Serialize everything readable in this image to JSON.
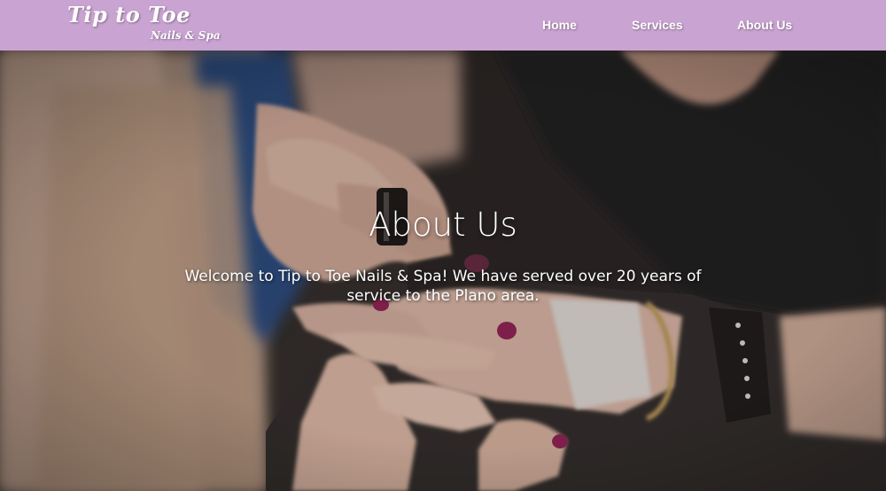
{
  "brand": {
    "title": "Tip to Toe",
    "subtitle": "Nails & Spa"
  },
  "nav": {
    "items": [
      {
        "label": "Home"
      },
      {
        "label": "Services"
      },
      {
        "label": "About Us"
      }
    ]
  },
  "hero": {
    "title": "About Us",
    "text": "Welcome to Tip to Toe Nails & Spa! We have served over 20 years of service to the Plano area.",
    "image_icon": "manicure-photo"
  },
  "colors": {
    "navbar": "#c9a3d1",
    "nav_text": "#ffffff",
    "polish": "#8e1f52",
    "overlay": "#282220"
  }
}
